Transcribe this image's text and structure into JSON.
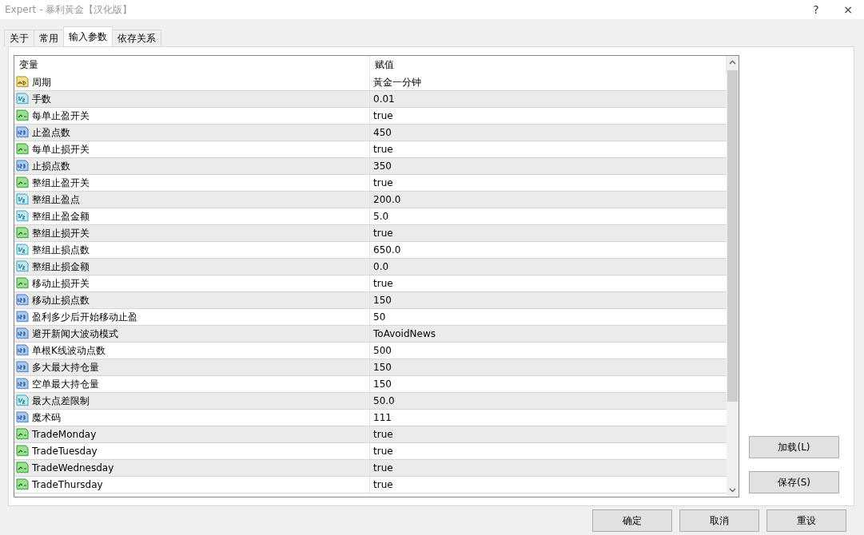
{
  "window": {
    "title": "Expert - 暴利黃金【汉化版】",
    "help": "?",
    "close": "×"
  },
  "tabs": [
    {
      "label": "关于",
      "selected": false
    },
    {
      "label": "常用",
      "selected": false
    },
    {
      "label": "输入参数",
      "selected": true
    },
    {
      "label": "依存关系",
      "selected": false
    }
  ],
  "table": {
    "columns": [
      "变量",
      "赋值"
    ],
    "rows": [
      {
        "kind": "string",
        "name": "周期",
        "value": "黃金一分钟"
      },
      {
        "kind": "double",
        "name": "手数",
        "value": "0.01"
      },
      {
        "kind": "bool",
        "name": "每单止盈开关",
        "value": "true"
      },
      {
        "kind": "int",
        "name": "止盈点数",
        "value": "450"
      },
      {
        "kind": "bool",
        "name": "每单止损开关",
        "value": "true"
      },
      {
        "kind": "int",
        "name": "止损点数",
        "value": "350"
      },
      {
        "kind": "bool",
        "name": "整组止盈开关",
        "value": "true"
      },
      {
        "kind": "double",
        "name": "整组止盈点",
        "value": "200.0"
      },
      {
        "kind": "double",
        "name": "整组止盈金额",
        "value": "5.0"
      },
      {
        "kind": "bool",
        "name": "整组止损开关",
        "value": "true"
      },
      {
        "kind": "double",
        "name": "整组止损点数",
        "value": "650.0"
      },
      {
        "kind": "double",
        "name": "整组止损金额",
        "value": "0.0"
      },
      {
        "kind": "bool",
        "name": "移动止损开关",
        "value": "true"
      },
      {
        "kind": "int",
        "name": "移动止损点数",
        "value": "150"
      },
      {
        "kind": "int",
        "name": "盈利多少后开始移动止盈",
        "value": "50"
      },
      {
        "kind": "int",
        "name": "避开新闻大波动模式",
        "value": "ToAvoidNews"
      },
      {
        "kind": "int",
        "name": "单根K线波动点数",
        "value": "500"
      },
      {
        "kind": "int",
        "name": "多大最大持仓量",
        "value": "150"
      },
      {
        "kind": "int",
        "name": "空单最大持仓量",
        "value": "150"
      },
      {
        "kind": "double",
        "name": "最大点差限制",
        "value": "50.0"
      },
      {
        "kind": "int",
        "name": "魔术码",
        "value": "111"
      },
      {
        "kind": "bool",
        "name": "TradeMonday",
        "value": "true"
      },
      {
        "kind": "bool",
        "name": "TradeTuesday",
        "value": "true"
      },
      {
        "kind": "bool",
        "name": "TradeWednesday",
        "value": "true"
      },
      {
        "kind": "bool",
        "name": "TradeThursday",
        "value": "true"
      }
    ]
  },
  "side_buttons": [
    "加载(L)",
    "保存(S)"
  ],
  "buttons": [
    "确定",
    "取消",
    "重设"
  ]
}
